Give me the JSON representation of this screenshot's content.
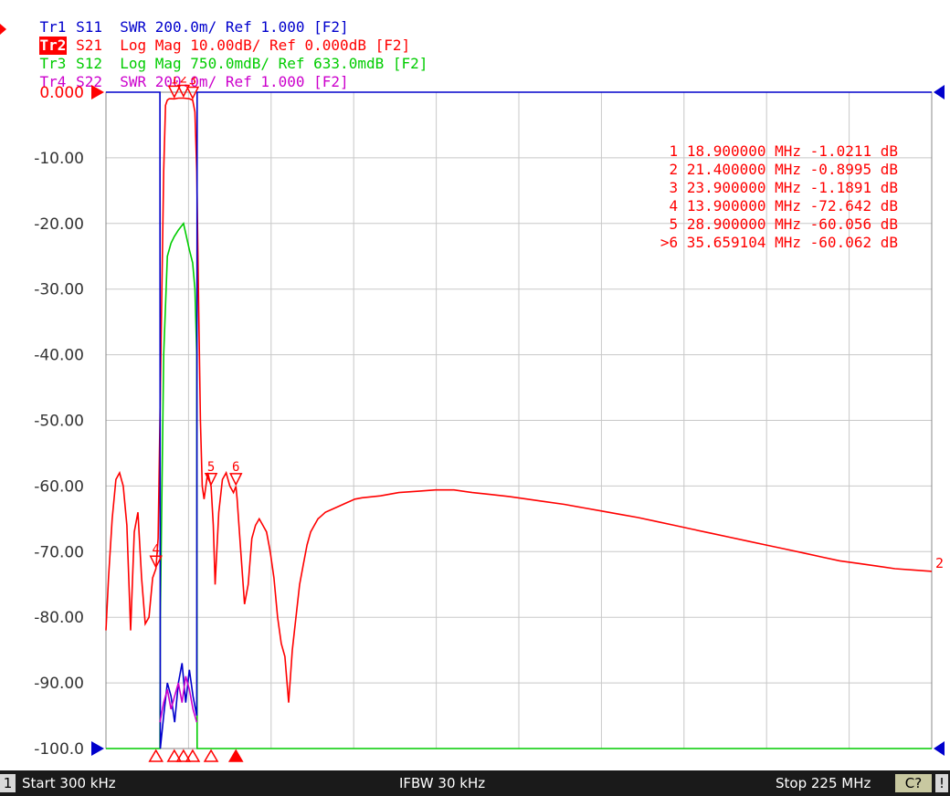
{
  "traces": [
    {
      "id": "Tr1",
      "text": " S11  SWR 200.0m/ Ref 1.000 [F2]",
      "color": "#0000cc",
      "active": false
    },
    {
      "id": "Tr2",
      "text": " S21  Log Mag 10.00dB/ Ref 0.000dB [F2]",
      "color": "#ff0000",
      "active": true
    },
    {
      "id": "Tr3",
      "text": " S12  Log Mag 750.0mdB/ Ref 633.0mdB [F2]",
      "color": "#00cc00",
      "active": false
    },
    {
      "id": "Tr4",
      "text": " S22  SWR 200.0m/ Ref 1.000 [F2]",
      "color": "#cc00cc",
      "active": false
    }
  ],
  "markers": [
    {
      "num": "1",
      "freq_mhz": 18.9,
      "value_db": -1.0211,
      "text": "1   18.900000 MHz -1.0211 dB"
    },
    {
      "num": "2",
      "freq_mhz": 21.4,
      "value_db": -0.8995,
      "text": "2   21.400000 MHz -0.8995 dB"
    },
    {
      "num": "3",
      "freq_mhz": 23.9,
      "value_db": -1.1891,
      "text": "3   23.900000 MHz -1.1891 dB"
    },
    {
      "num": "4",
      "freq_mhz": 13.9,
      "value_db": -72.642,
      "text": "4   13.900000 MHz -72.642 dB"
    },
    {
      "num": "5",
      "freq_mhz": 28.9,
      "value_db": -60.056,
      "text": "5   28.900000 MHz -60.056 dB"
    },
    {
      "num": "6",
      "freq_mhz": 35.659104,
      "value_db": -60.062,
      "text": ">6   35.659104 MHz -60.062 dB"
    }
  ],
  "status": {
    "channel": "1",
    "start": "Start 300 kHz",
    "ifbw": "IFBW 30 kHz",
    "stop": "Stop 225 MHz",
    "cal": "C?",
    "warn": "!"
  },
  "colors": {
    "s11": "#0000cc",
    "s21": "#ff0000",
    "s12": "#00cc00",
    "s22": "#cc00cc",
    "grid": "#c8c8c8",
    "marker_text": "#ff0000"
  },
  "chart_data": {
    "type": "line",
    "xlim_mhz": [
      0.3,
      225
    ],
    "ylim": [
      -100,
      0
    ],
    "yticks": [
      "0.000",
      "-10.00",
      "-20.00",
      "-30.00",
      "-40.00",
      "-50.00",
      "-60.00",
      "-70.00",
      "-80.00",
      "-90.00",
      "-100.0"
    ],
    "grid": true,
    "series": [
      {
        "name": "S21",
        "color": "#ff0000",
        "x": [
          0.3,
          1,
          2,
          3,
          4,
          5,
          6,
          7,
          8,
          9,
          10,
          11,
          12,
          13,
          13.9,
          14.5,
          15,
          15.5,
          16,
          16.5,
          17,
          17.5,
          18,
          18.9,
          20,
          21.4,
          23,
          23.9,
          24.5,
          25,
          25.5,
          26,
          26.5,
          27,
          27.5,
          28,
          28.9,
          29.5,
          30,
          31,
          32,
          33,
          34,
          35,
          35.66,
          36,
          37,
          38,
          39,
          40,
          41,
          42,
          43,
          44,
          45,
          46,
          47,
          48,
          49,
          50,
          51,
          52,
          53,
          54,
          55,
          56,
          57,
          58,
          59,
          60,
          62,
          64,
          66,
          68,
          70,
          75,
          80,
          85,
          90,
          95,
          100,
          105,
          110,
          115,
          120,
          125,
          130,
          135,
          140,
          145,
          150,
          155,
          160,
          165,
          170,
          175,
          180,
          185,
          190,
          195,
          200,
          205,
          210,
          215,
          220,
          225
        ],
        "values": [
          -82,
          -74,
          -65,
          -59,
          -58,
          -60,
          -66,
          -82,
          -67,
          -64,
          -74,
          -81,
          -80,
          -74,
          -72.6,
          -68,
          -50,
          -30,
          -12,
          -2,
          -1.2,
          -1.0,
          -1.0,
          -1.02,
          -0.9,
          -0.9,
          -1.0,
          -1.19,
          -3,
          -12,
          -32,
          -50,
          -60,
          -62,
          -60,
          -58,
          -60.06,
          -66,
          -75,
          -64,
          -59,
          -58,
          -60,
          -61,
          -60.06,
          -62,
          -70,
          -78,
          -75,
          -68,
          -66,
          -65,
          -66,
          -67,
          -70,
          -74,
          -80,
          -84,
          -86,
          -93,
          -85,
          -80,
          -75,
          -72,
          -69,
          -67,
          -66,
          -65,
          -64.5,
          -64,
          -63.5,
          -63,
          -62.5,
          -62,
          -61.8,
          -61.5,
          -61,
          -60.8,
          -60.6,
          -60.6,
          -61,
          -61.3,
          -61.6,
          -62,
          -62.4,
          -62.8,
          -63.3,
          -63.8,
          -64.3,
          -64.8,
          -65.4,
          -66,
          -66.6,
          -67.2,
          -67.8,
          -68.4,
          -69,
          -69.6,
          -70.2,
          -70.8,
          -71.4,
          -71.8,
          -72.2,
          -72.6,
          -72.8,
          -73
        ]
      },
      {
        "name": "S12",
        "color": "#00cc00",
        "x": [
          0.3,
          15,
          15.1,
          16,
          17,
          18,
          18.9,
          20,
          21.4,
          23,
          23.9,
          24.5,
          25,
          25.1,
          225
        ],
        "values": [
          -100,
          -100,
          -80,
          -40,
          -25,
          -23,
          -22,
          -21,
          -20,
          -24,
          -26,
          -30,
          -40,
          -100,
          -100
        ]
      },
      {
        "name": "S11",
        "color": "#0000cc",
        "x": [
          0.3,
          15,
          15.1,
          16,
          17,
          18,
          19,
          20,
          21,
          22,
          23,
          24,
          25,
          25.1,
          225
        ],
        "values": [
          0,
          0,
          -100,
          -95,
          -90,
          -92,
          -96,
          -90,
          -87,
          -93,
          -88,
          -92,
          -95,
          0,
          0
        ]
      },
      {
        "name": "S22",
        "color": "#cc00cc",
        "x": [
          15,
          16,
          17,
          18,
          19,
          20,
          21,
          22,
          23,
          24,
          25
        ],
        "values": [
          -96,
          -93,
          -91,
          -94,
          -92,
          -90,
          -93,
          -89,
          -91,
          -94,
          -96
        ]
      }
    ]
  }
}
